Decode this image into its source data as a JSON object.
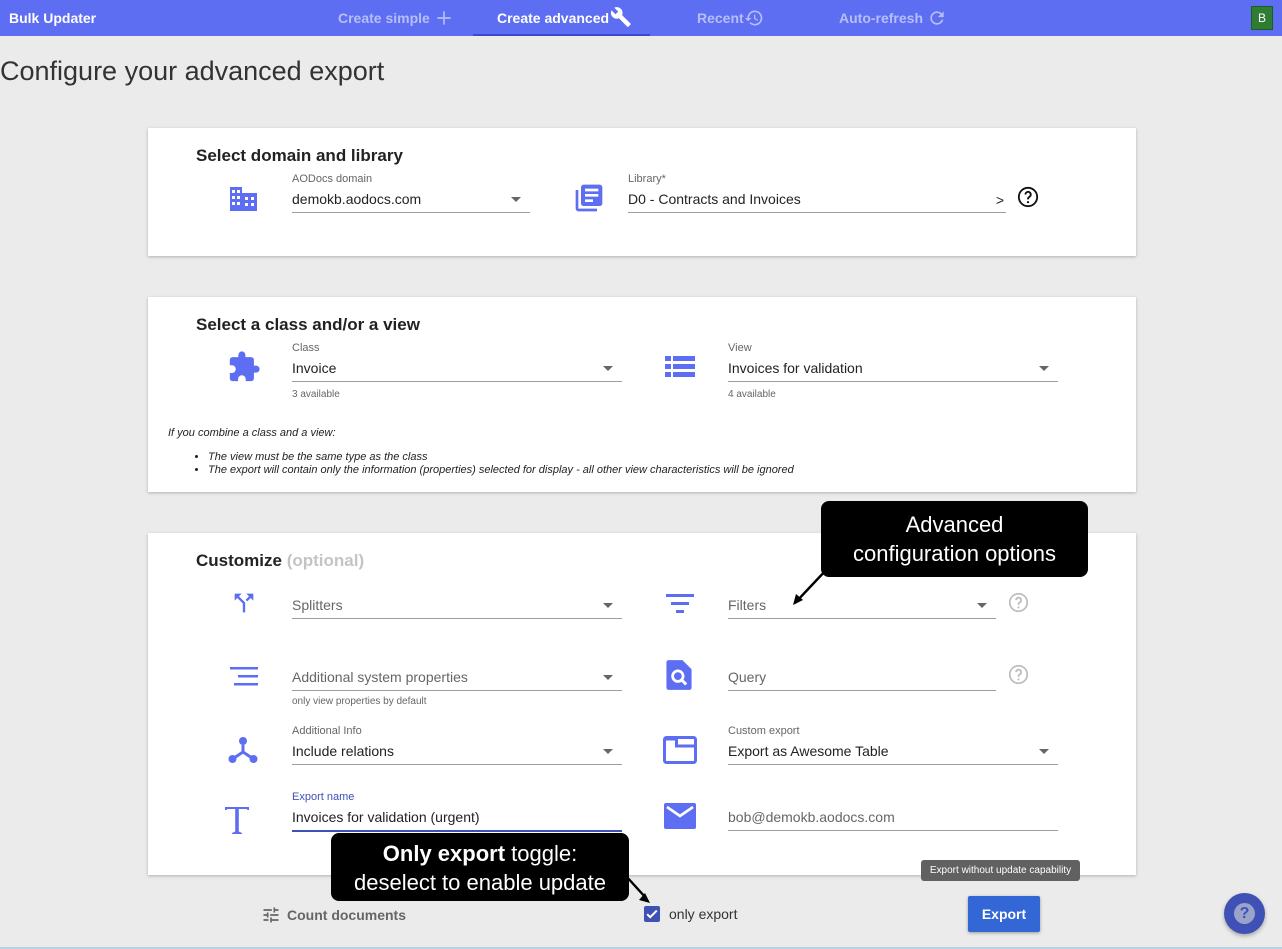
{
  "app": {
    "name": "Bulk Updater"
  },
  "nav": {
    "create_simple": "Create simple",
    "create_advanced": "Create advanced",
    "recent": "Recent",
    "auto_refresh": "Auto-refresh"
  },
  "user": {
    "initial": "B"
  },
  "page": {
    "title": "Configure your advanced export"
  },
  "domain_section": {
    "title": "Select domain and library",
    "domain_label": "AODocs domain",
    "domain_value": "demokb.aodocs.com",
    "library_label": "Library*",
    "library_value": "D0 - Contracts and Invoices",
    "library_arrow": ">"
  },
  "class_section": {
    "title": "Select a class and/or a view",
    "class_label": "Class",
    "class_value": "Invoice",
    "class_hint": "3 available",
    "view_label": "View",
    "view_value": "Invoices for validation",
    "view_hint": "4 available",
    "note_intro": "If you combine a class and a view:",
    "note_items": [
      "The view must be the same type as the class",
      "The export will contain only the information (properties) selected for display - all other view characteristics will be ignored"
    ]
  },
  "customize_section": {
    "title": "Customize",
    "title_suffix": "(optional)",
    "splitters_placeholder": "Splitters",
    "filters_placeholder": "Filters",
    "system_props_placeholder": "Additional system properties",
    "system_props_hint": "only view properties by default",
    "query_placeholder": "Query",
    "additional_info_label": "Additional Info",
    "additional_info_value": "Include relations",
    "custom_export_label": "Custom export",
    "custom_export_value": "Export as Awesome Table",
    "export_name_label": "Export name",
    "export_name_value": "Invoices for validation (urgent)",
    "email_placeholder": "bob@demokb.aodocs.com"
  },
  "callouts": {
    "advanced_line1": "Advanced",
    "advanced_line2": "configuration options",
    "toggle_bold": "Only export",
    "toggle_rest": " toggle:",
    "toggle_line2": "deselect to enable update"
  },
  "footer": {
    "count_documents": "Count documents",
    "only_export_label": "only export",
    "only_export_checked": true,
    "export_button": "Export",
    "export_tooltip": "Export without update capability"
  },
  "colors": {
    "topbar": "#5d6ef2",
    "accent": "#3f51b5",
    "export_button": "#3367d6",
    "avatar": "#2e7d32"
  },
  "icons": [
    "plus-icon",
    "wrench-icon",
    "history-icon",
    "refresh-icon",
    "building-icon",
    "library-icon",
    "help-icon",
    "puzzle-icon",
    "list-view-icon",
    "split-icon",
    "filter-icon",
    "sort-lines-icon",
    "search-doc-icon",
    "relations-icon",
    "folder-icon",
    "text-icon",
    "mail-icon",
    "tune-icon",
    "check-icon"
  ]
}
